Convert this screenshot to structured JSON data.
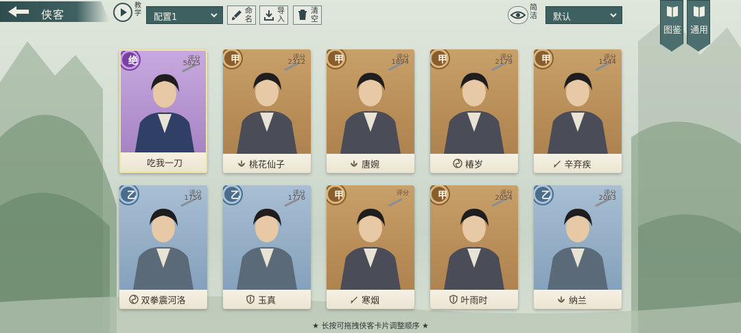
{
  "header": {
    "title": "侠客",
    "tutorial_label": "教学",
    "preset_value": "配置1",
    "rename_label": "命名",
    "import_label": "导入",
    "clear_label": "清空",
    "compact_label": "简洁",
    "sort_value": "默认",
    "codex_label": "图鉴",
    "general_label": "通用"
  },
  "cards": [
    {
      "name": "吃我一刀",
      "rank": "绝",
      "score_label": "评分",
      "score": "5825",
      "tier": "jue",
      "faction": "none"
    },
    {
      "name": "桃花仙子",
      "rank": "甲",
      "score_label": "评分",
      "score": "2312",
      "tier": "jia",
      "faction": "lotus"
    },
    {
      "name": "唐婉",
      "rank": "甲",
      "score_label": "评分",
      "score": "1894",
      "tier": "jia",
      "faction": "lotus"
    },
    {
      "name": "椿岁",
      "rank": "甲",
      "score_label": "评分",
      "score": "2179",
      "tier": "jia",
      "faction": "swirl"
    },
    {
      "name": "辛弃疾",
      "rank": "甲",
      "score_label": "评分",
      "score": "1544",
      "tier": "jia",
      "faction": "sword"
    },
    {
      "name": "双拳震河洛",
      "rank": "乙",
      "score_label": "评分",
      "score": "1756",
      "tier": "yi",
      "faction": "swirl"
    },
    {
      "name": "玉真",
      "rank": "乙",
      "score_label": "评分",
      "score": "1776",
      "tier": "yi",
      "faction": "shield"
    },
    {
      "name": "寒烟",
      "rank": "甲",
      "score_label": "评分",
      "score": "",
      "tier": "jia",
      "faction": "sword"
    },
    {
      "name": "叶雨时",
      "rank": "甲",
      "score_label": "评分",
      "score": "2054",
      "tier": "jia",
      "faction": "shield"
    },
    {
      "name": "纳兰",
      "rank": "乙",
      "score_label": "评分",
      "score": "2063",
      "tier": "yi",
      "faction": "lotus"
    }
  ],
  "footer": {
    "hint": "★ 长按可拖拽侠客卡片调整顺序 ★"
  },
  "colors": {
    "accent": "#3f6061",
    "jia": "#b58a55",
    "yi": "#8fa9c2",
    "jue": "#b08fcc"
  }
}
